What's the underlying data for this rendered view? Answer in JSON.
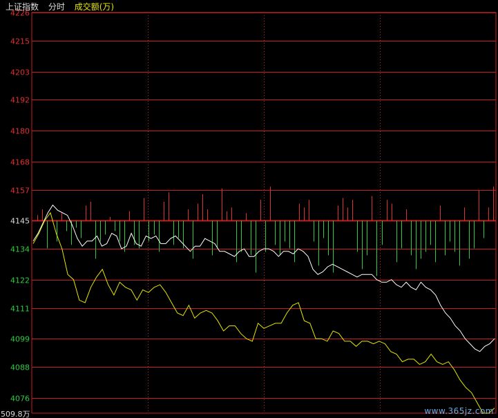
{
  "header": {
    "index_name": "上证指数",
    "mode": "分时",
    "volume_label": "成交额(万)"
  },
  "watermark": "www.365jz.com",
  "colors": {
    "background": "#000000",
    "grid": "#c81e1e",
    "axis_up": "#e03030",
    "axis_down": "#2ecc40",
    "axis_neutral": "#dcdcdc",
    "price_line": "#ffffff",
    "avg_line": "#e6e600",
    "bar_up": "#e03030",
    "bar_down": "#2ecc40"
  },
  "chart_data": {
    "type": "line",
    "ylim": [
      4070,
      4226
    ],
    "base_value": 4145,
    "y_ticks": [
      4226,
      4215,
      4203,
      4192,
      4180,
      4168,
      4157,
      4145,
      4134,
      4122,
      4111,
      4099,
      4088,
      4076
    ],
    "bottom_label": "509.8万",
    "series": [
      {
        "line": "price",
        "values": [
          4137,
          4140,
          4144,
          4148,
          4151,
          4149,
          4148,
          4147,
          4143,
          4138,
          4135,
          4137,
          4137,
          4139,
          4135,
          4136,
          4140,
          4139,
          4134,
          4135,
          4140,
          4136,
          4135,
          4139,
          4138,
          4139,
          4136,
          4136,
          4138,
          4139,
          4137,
          4135,
          4133,
          4135,
          4135,
          4138,
          4137,
          4136,
          4133,
          4133,
          4132,
          4131,
          4133,
          4134,
          4131,
          4131,
          4133,
          4134,
          4134,
          4133,
          4131,
          4133,
          4133,
          4132,
          4134,
          4133,
          4131,
          4126,
          4124,
          4125,
          4127,
          4128,
          4127,
          4126,
          4125,
          4124,
          4123,
          4124,
          4124,
          4124,
          4122,
          4121,
          4121,
          4122,
          4120,
          4119,
          4121,
          4119,
          4118,
          4121,
          4119,
          4118,
          4116,
          4112,
          4109,
          4107,
          4104,
          4102,
          4099,
          4097,
          4095,
          4094,
          4096,
          4097,
          4099
        ]
      },
      {
        "line": "average",
        "values": [
          4136,
          4140,
          4145,
          4148,
          4140,
          4134,
          4124,
          4122,
          4114,
          4113,
          4119,
          4123,
          4126,
          4120,
          4116,
          4121,
          4119,
          4118,
          4114,
          4118,
          4117,
          4119,
          4120,
          4117,
          4113,
          4109,
          4108,
          4112,
          4107,
          4109,
          4110,
          4109,
          4106,
          4102,
          4104,
          4104,
          4101,
          4099,
          4098,
          4105,
          4103,
          4104,
          4105,
          4105,
          4109,
          4112,
          4113,
          4106,
          4105,
          4099,
          4099,
          4098,
          4102,
          4101,
          4098,
          4098,
          4096,
          4098,
          4098,
          4097,
          4098,
          4097,
          4094,
          4093,
          4090,
          4091,
          4091,
          4089,
          4090,
          4093,
          4090,
          4089,
          4090,
          4087,
          4083,
          4080,
          4078,
          4074,
          4070,
          4070,
          4072
        ]
      }
    ],
    "volume": {
      "values": [
        3,
        6,
        8,
        0,
        6,
        4,
        3,
        7,
        2,
        5,
        8,
        10,
        11,
        6,
        4,
        2,
        3,
        6,
        9,
        5,
        7,
        8,
        12,
        6,
        4,
        9,
        10,
        15,
        7,
        5,
        8,
        6,
        11,
        9,
        14,
        6,
        10,
        8,
        17,
        5,
        7,
        12,
        9,
        4,
        10,
        15,
        11,
        9,
        18,
        7,
        10,
        6,
        8,
        12,
        9,
        7,
        11,
        6,
        13,
        5,
        10,
        15,
        8,
        12,
        7,
        11,
        9,
        14,
        10,
        13,
        16,
        7,
        11,
        9,
        12,
        8,
        6,
        10,
        14,
        11,
        9,
        7,
        12,
        8,
        10,
        6,
        9,
        13,
        7,
        11,
        8,
        16,
        5,
        7,
        18
      ],
      "up": [
        1,
        1,
        0,
        0,
        0,
        1,
        0,
        0,
        0,
        0,
        1,
        1,
        0,
        0,
        0,
        1,
        0,
        0,
        0,
        1,
        0,
        0,
        1,
        0,
        0,
        0,
        1,
        1,
        0,
        0,
        0,
        1,
        0,
        1,
        1,
        1,
        0,
        0,
        1,
        1,
        1,
        0,
        0,
        1,
        0,
        0,
        1,
        0,
        1,
        0,
        0,
        0,
        0,
        0,
        1,
        1,
        1,
        0,
        0,
        0,
        0,
        0,
        1,
        1,
        1,
        1,
        0,
        0,
        0,
        1,
        0,
        0,
        1,
        1,
        0,
        0,
        1,
        0,
        0,
        0,
        0,
        0,
        0,
        1,
        0,
        0,
        0,
        0,
        1,
        0,
        0,
        1,
        0,
        1,
        1
      ]
    }
  }
}
